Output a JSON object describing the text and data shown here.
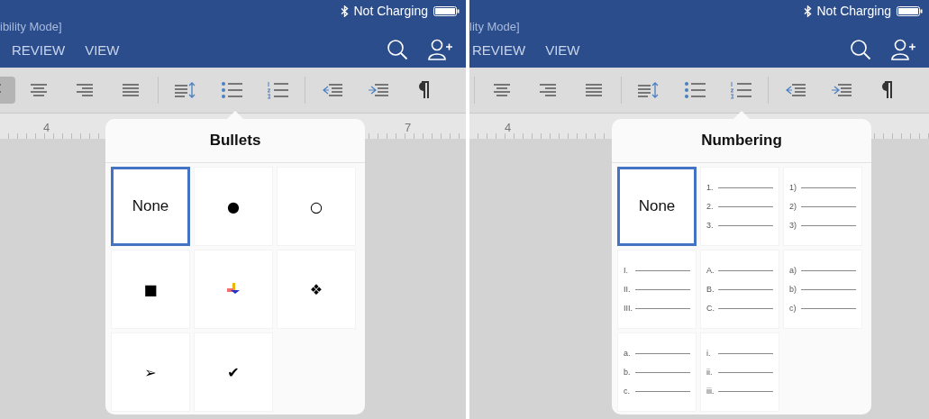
{
  "panels": [
    {
      "title": "ibility Mode]",
      "status": "Not Charging",
      "tabs": [
        {
          "label": "REVIEW"
        },
        {
          "label": "VIEW"
        }
      ],
      "toolbar": [
        {
          "kind": "align-left",
          "selected": true
        },
        {
          "kind": "align-center",
          "selected": false
        },
        {
          "kind": "align-right",
          "selected": false
        },
        {
          "kind": "justify",
          "selected": false
        },
        {
          "kind": "divider"
        },
        {
          "kind": "line-spacing",
          "selected": false
        },
        {
          "kind": "bullets",
          "selected": false
        },
        {
          "kind": "numbering",
          "selected": false
        },
        {
          "kind": "divider"
        },
        {
          "kind": "outdent",
          "selected": false
        },
        {
          "kind": "indent",
          "selected": false
        },
        {
          "kind": "pilcrow",
          "selected": false
        }
      ],
      "ruler": [
        "4",
        "7"
      ],
      "popover": {
        "title": "Bullets",
        "cells": [
          {
            "kind": "none",
            "label": "None",
            "selected": true
          },
          {
            "kind": "glyph",
            "glyph": "●",
            "selected": false
          },
          {
            "kind": "glyph",
            "glyph": "○",
            "selected": false
          },
          {
            "kind": "glyph",
            "glyph": "■",
            "selected": false
          },
          {
            "kind": "picture-bullet",
            "selected": false
          },
          {
            "kind": "glyph",
            "glyph": "❖",
            "selected": false
          },
          {
            "kind": "glyph",
            "glyph": "➢",
            "selected": false
          },
          {
            "kind": "glyph",
            "glyph": "✔",
            "selected": false
          }
        ]
      }
    },
    {
      "title": "lity Mode]",
      "status": "Not Charging",
      "tabs": [
        {
          "label": "REVIEW"
        },
        {
          "label": "VIEW"
        }
      ],
      "toolbar": [
        {
          "kind": "divider"
        },
        {
          "kind": "align-center",
          "selected": false
        },
        {
          "kind": "align-right",
          "selected": false
        },
        {
          "kind": "justify",
          "selected": false
        },
        {
          "kind": "divider"
        },
        {
          "kind": "line-spacing",
          "selected": false
        },
        {
          "kind": "bullets",
          "selected": false
        },
        {
          "kind": "numbering",
          "selected": false
        },
        {
          "kind": "divider"
        },
        {
          "kind": "outdent",
          "selected": false
        },
        {
          "kind": "indent",
          "selected": false
        },
        {
          "kind": "pilcrow",
          "selected": false
        }
      ],
      "ruler": [
        "4"
      ],
      "popover": {
        "title": "Numbering",
        "cells": [
          {
            "kind": "none",
            "label": "None",
            "selected": true
          },
          {
            "kind": "list",
            "markers": [
              "1.",
              "2.",
              "3."
            ],
            "selected": false
          },
          {
            "kind": "list",
            "markers": [
              "1)",
              "2)",
              "3)"
            ],
            "selected": false
          },
          {
            "kind": "list",
            "markers": [
              "I.",
              "II.",
              "III."
            ],
            "selected": false
          },
          {
            "kind": "list",
            "markers": [
              "A.",
              "B.",
              "C."
            ],
            "selected": false
          },
          {
            "kind": "list",
            "markers": [
              "a)",
              "b)",
              "c)"
            ],
            "selected": false
          },
          {
            "kind": "list",
            "markers": [
              "a.",
              "b.",
              "c."
            ],
            "selected": false
          },
          {
            "kind": "list",
            "markers": [
              "i.",
              "ii.",
              "iii."
            ],
            "selected": false
          }
        ]
      }
    }
  ]
}
